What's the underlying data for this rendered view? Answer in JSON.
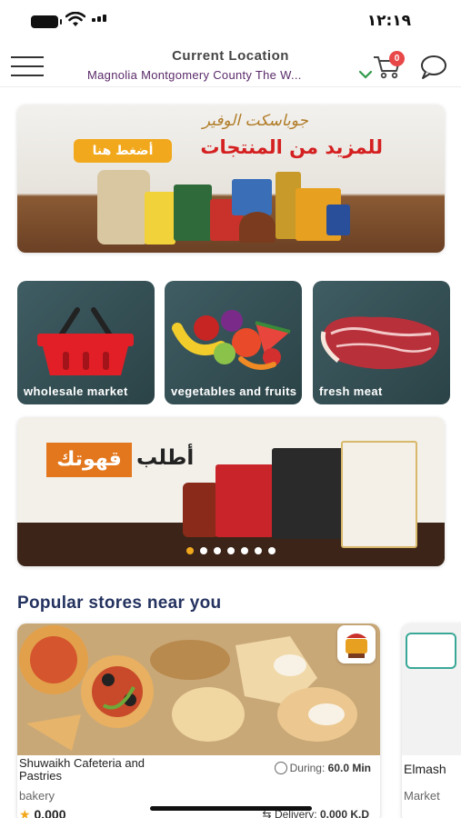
{
  "status_bar": {
    "time": "١٢:١٩"
  },
  "header": {
    "location_title": "Current Location",
    "location_value": "Magnolia Montgomery County The W...",
    "cart_count": "0"
  },
  "banner_top": {
    "script_text": "جوباسكت الوفير",
    "headline": "للمزيد من المنتجات",
    "cta": "أضغط هنا"
  },
  "categories": [
    {
      "label": "wholesale market",
      "icon": "shopping-basket-icon"
    },
    {
      "label": "vegetables and fruits",
      "icon": "fruits-icon"
    },
    {
      "label": "fresh meat",
      "icon": "meat-icon"
    }
  ],
  "banner_promo": {
    "tag": "قهوتك",
    "text": "أطلب",
    "dots": 7,
    "active_dot": 0
  },
  "section": {
    "title": "Popular stores near you"
  },
  "stores": [
    {
      "name": "Shuwaikh Cafeteria and Pastries",
      "category": "bakery",
      "time_label": "During:",
      "time_value": "60.0 Min",
      "rating": "0.000",
      "delivery_label": "Delivery:",
      "delivery_value": "0.000 K.D"
    },
    {
      "name": "Elmash",
      "category": "Market"
    }
  ],
  "colors": {
    "accent": "#f2a81c",
    "tile_bg": "#3f5d63",
    "title": "#24325f",
    "location": "#5a2a6a",
    "badge": "#e84848"
  }
}
